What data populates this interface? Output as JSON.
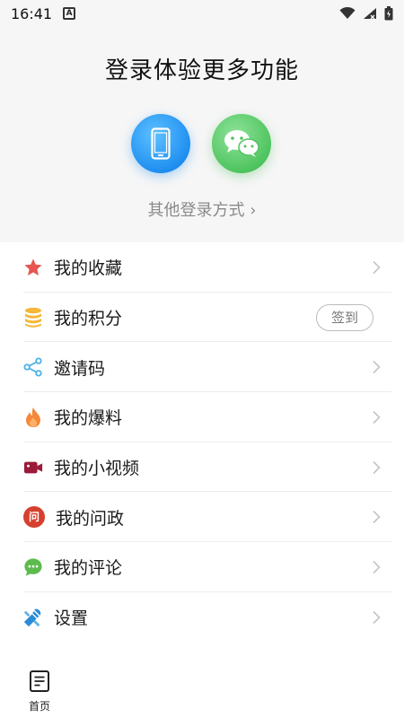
{
  "status_bar": {
    "time": "16:41",
    "indicator": "A"
  },
  "login": {
    "title": "登录体验更多功能",
    "other_methods": "其他登录方式 ›"
  },
  "menu": {
    "items": [
      {
        "label": "我的收藏",
        "icon": "star-icon"
      },
      {
        "label": "我的积分",
        "icon": "coins-icon",
        "badge": "签到"
      },
      {
        "label": "邀请码",
        "icon": "share-icon"
      },
      {
        "label": "我的爆料",
        "icon": "flame-icon"
      },
      {
        "label": "我的小视频",
        "icon": "video-camera-icon"
      },
      {
        "label": "我的问政",
        "icon": "question-badge-icon",
        "icon_text": "问"
      },
      {
        "label": "我的评论",
        "icon": "comment-icon"
      },
      {
        "label": "设置",
        "icon": "settings-icon"
      }
    ]
  },
  "bottom_nav": {
    "home_label": "首页"
  },
  "colors": {
    "header_bg": "#f6f6f6",
    "phone_blue": "#1f8ff0",
    "wechat_green": "#4fc45f",
    "star_red": "#e8554e",
    "coin_yellow": "#f4b73a",
    "share_blue": "#4ab0e6",
    "flame_orange": "#f5883a",
    "video_maroon": "#9b1b3a",
    "question_red": "#d6402e",
    "comment_green": "#5dbb4d",
    "settings_blue": "#2a8bd8"
  }
}
